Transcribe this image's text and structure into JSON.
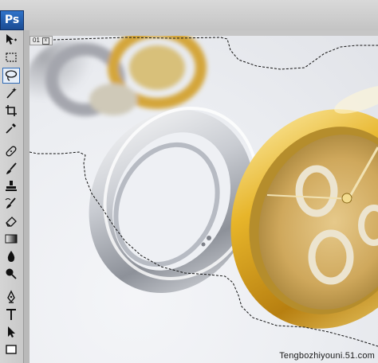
{
  "app": {
    "logo_text": "Ps"
  },
  "document": {
    "tab_label": "01",
    "close_symbol": "x"
  },
  "canvas": {
    "watermark_text": "Tengbozhiyouni.51.com"
  },
  "tools": [
    {
      "name": "move-tool",
      "icon": "move-icon",
      "active": false
    },
    {
      "name": "marquee-tool",
      "icon": "marquee-icon",
      "active": false
    },
    {
      "name": "lasso-tool",
      "icon": "lasso-icon",
      "active": true
    },
    {
      "name": "magic-wand-tool",
      "icon": "magic-wand-icon",
      "active": false
    },
    {
      "name": "crop-tool",
      "icon": "crop-icon",
      "active": false
    },
    {
      "name": "eyedropper-tool",
      "icon": "eyedropper-icon",
      "active": false
    },
    {
      "name": "healing-brush-tool",
      "icon": "bandage-icon",
      "active": false
    },
    {
      "name": "brush-tool",
      "icon": "brush-icon",
      "active": false
    },
    {
      "name": "clone-stamp-tool",
      "icon": "stamp-icon",
      "active": false
    },
    {
      "name": "history-brush-tool",
      "icon": "history-brush-icon",
      "active": false
    },
    {
      "name": "eraser-tool",
      "icon": "eraser-icon",
      "active": false
    },
    {
      "name": "gradient-tool",
      "icon": "gradient-icon",
      "active": false
    },
    {
      "name": "blur-tool",
      "icon": "drop-icon",
      "active": false
    },
    {
      "name": "dodge-tool",
      "icon": "dodge-icon",
      "active": false
    },
    {
      "name": "pen-tool",
      "icon": "pen-icon",
      "active": false
    },
    {
      "name": "type-tool",
      "icon": "type-icon",
      "active": false
    },
    {
      "name": "path-selection-tool",
      "icon": "arrow-icon",
      "active": false
    },
    {
      "name": "rectangle-tool",
      "icon": "rectangle-icon",
      "active": false
    }
  ],
  "colors": {
    "accent": "#2f6bb7",
    "gold": "#d9a928",
    "silver": "#c8ccd2"
  }
}
